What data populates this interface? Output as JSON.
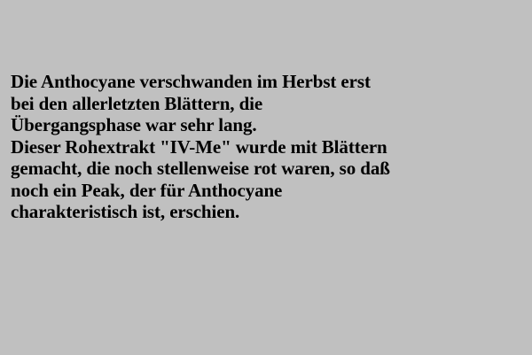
{
  "slide": {
    "background_color": "#c0c0c0",
    "text_color": "#000000",
    "lines": [
      "Die Anthocyane verschwanden im Herbst erst",
      "bei den allerletzten Blättern, die",
      "Übergangsphase war sehr lang.",
      "Dieser Rohextrakt \"IV-Me\" wurde mit Blättern",
      "gemacht, die noch stellenweise rot waren, so daß",
      "noch ein Peak, der für Anthocyane",
      "charakteristisch ist, erschien."
    ]
  }
}
